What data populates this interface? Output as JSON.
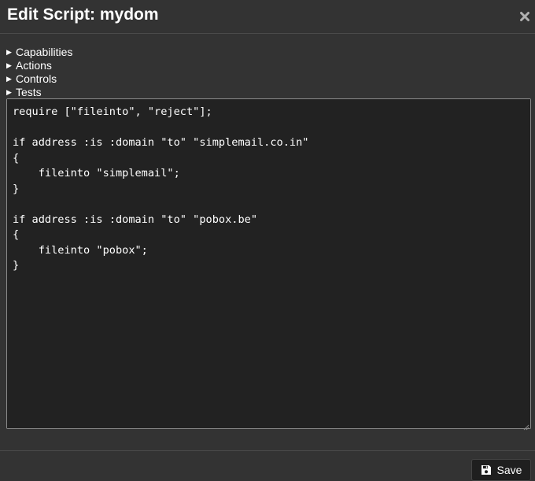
{
  "dialog": {
    "title": "Edit Script: mydom",
    "close_icon": "close-icon"
  },
  "toggles": [
    {
      "label": "Capabilities",
      "icon": "triangle-right-icon"
    },
    {
      "label": "Actions",
      "icon": "triangle-right-icon"
    },
    {
      "label": "Controls",
      "icon": "triangle-right-icon"
    },
    {
      "label": "Tests",
      "icon": "triangle-right-icon"
    }
  ],
  "editor": {
    "content": "require [\"fileinto\", \"reject\"];\n\nif address :is :domain \"to\" \"simplemail.co.in\"\n{\n    fileinto \"simplemail\";\n}\n\nif address :is :domain \"to\" \"pobox.be\"\n{\n    fileinto \"pobox\";\n}"
  },
  "footer": {
    "save_label": "Save",
    "save_icon": "floppy-disk-icon"
  },
  "colors": {
    "background": "#333333",
    "editor_background": "#222222",
    "text": "#ffffff",
    "close_icon": "#b0b0b0"
  }
}
